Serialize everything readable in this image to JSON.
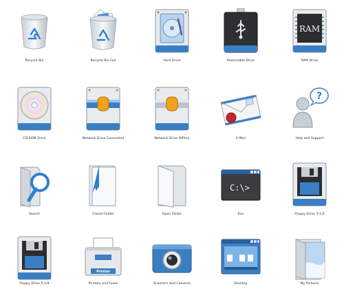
{
  "icons": [
    {
      "label": "Recycle Bin",
      "icon": "recycle-bin-icon"
    },
    {
      "label": "Recycle Bin Full",
      "icon": "recycle-bin-full-icon"
    },
    {
      "label": "Hard Drive",
      "icon": "hard-drive-icon"
    },
    {
      "label": "Removable Drive",
      "icon": "removable-drive-icon"
    },
    {
      "label": "RAM Drive",
      "icon": "ram-drive-icon",
      "badge": "RAM"
    },
    {
      "label": "CD-ROM Drive",
      "icon": "cdrom-drive-icon"
    },
    {
      "label": "Network Drive Connected",
      "icon": "network-drive-connected-icon"
    },
    {
      "label": "Network Drive Offline",
      "icon": "network-drive-offline-icon"
    },
    {
      "label": "E-Mail",
      "icon": "email-icon"
    },
    {
      "label": "Help and Support",
      "icon": "help-support-icon",
      "badge": "?"
    },
    {
      "label": "Search",
      "icon": "search-folder-icon"
    },
    {
      "label": "Closed Folder",
      "icon": "closed-folder-icon"
    },
    {
      "label": "Open Folder",
      "icon": "open-folder-icon"
    },
    {
      "label": "Run",
      "icon": "run-console-icon",
      "badge": "C:\\>"
    },
    {
      "label": "Floppy Drive 3-1/2",
      "icon": "floppy-35-icon"
    },
    {
      "label": "Floppy Drive 5-1/4",
      "icon": "floppy-525-icon"
    },
    {
      "label": "Printers and Faxes",
      "icon": "printer-icon",
      "badge": "Printer"
    },
    {
      "label": "Scanners and Cameras",
      "icon": "camera-icon"
    },
    {
      "label": "Desktop",
      "icon": "desktop-icon"
    },
    {
      "label": "My Pictures",
      "icon": "my-pictures-icon"
    }
  ],
  "colors": {
    "accent": "#3a7fc4",
    "text": "#222222"
  }
}
